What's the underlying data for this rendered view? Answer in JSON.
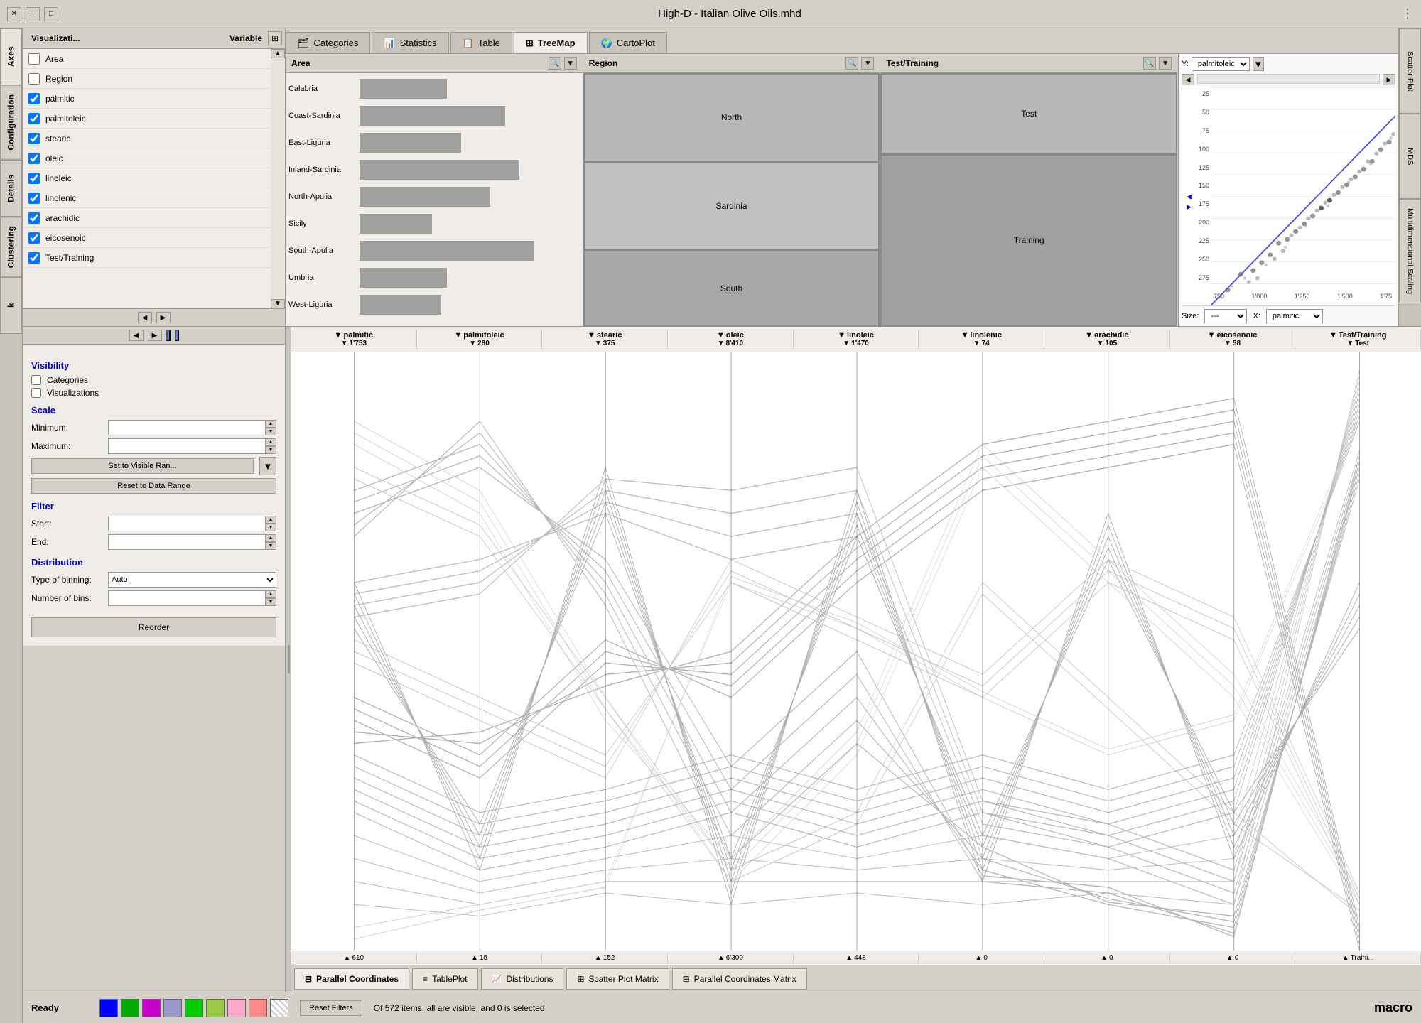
{
  "titlebar": {
    "title": "High-D - Italian Olive Oils.mhd",
    "close_btn": "✕",
    "min_btn": "−",
    "max_btn": "□"
  },
  "left_sidebar": {
    "tabs": [
      "Axes",
      "Configuration",
      "Details",
      "Clustering",
      "k"
    ]
  },
  "variable_panel": {
    "col1_label": "Visualizati...",
    "col2_label": "Variable",
    "variables": [
      {
        "name": "Area",
        "checked": false
      },
      {
        "name": "Region",
        "checked": false
      },
      {
        "name": "palmitic",
        "checked": true
      },
      {
        "name": "palmitoleic",
        "checked": true
      },
      {
        "name": "stearic",
        "checked": true
      },
      {
        "name": "oleic",
        "checked": true
      },
      {
        "name": "linoleic",
        "checked": true
      },
      {
        "name": "linolenic",
        "checked": true
      },
      {
        "name": "arachidic",
        "checked": true
      },
      {
        "name": "eicosenoic",
        "checked": true
      },
      {
        "name": "Test/Training",
        "checked": true
      }
    ]
  },
  "viz_tabs": {
    "tabs": [
      "Categories",
      "Statistics",
      "Table",
      "TreeMap",
      "CartoPlot"
    ],
    "active": "TreeMap"
  },
  "categories": {
    "area": {
      "label": "Area",
      "items": [
        {
          "name": "Calabria",
          "width": 0.3
        },
        {
          "name": "Coast-Sardinia",
          "width": 0.5
        },
        {
          "name": "East-Liguria",
          "width": 0.35
        },
        {
          "name": "Inland-Sardinia",
          "width": 0.55
        },
        {
          "name": "North-Apulia",
          "width": 0.45
        },
        {
          "name": "Sicily",
          "width": 0.25
        },
        {
          "name": "South-Apulia",
          "width": 0.6
        },
        {
          "name": "Umbria",
          "width": 0.3
        },
        {
          "name": "West-Liguria",
          "width": 0.28
        }
      ]
    },
    "region": {
      "label": "Region",
      "items": [
        {
          "name": "North",
          "width": 0.45
        },
        {
          "name": "Sardinia",
          "width": 0.55
        },
        {
          "name": "South",
          "width": 0.5
        }
      ]
    },
    "test_training": {
      "label": "Test/Training",
      "items": [
        {
          "name": "Test",
          "width": 0.35
        },
        {
          "name": "Training",
          "width": 0.65
        }
      ]
    }
  },
  "scatter": {
    "y_label": "Y:",
    "y_value": "palmitoleic",
    "size_label": "Size:",
    "size_value": "---",
    "x_label": "X:",
    "x_value": "palmitic",
    "y_axis_values": [
      "275",
      "250",
      "225",
      "200",
      "175",
      "150",
      "125",
      "100",
      "75",
      "50",
      "25"
    ],
    "x_axis_values": [
      "750",
      "1'000",
      "1'250",
      "1'500",
      "1'75"
    ]
  },
  "config": {
    "visibility_title": "Visibility",
    "categories_label": "Categories",
    "visualizations_label": "Visualizations",
    "scale_title": "Scale",
    "minimum_label": "Minimum:",
    "maximum_label": "Maximum:",
    "set_visible_btn": "Set to Visible Ran...",
    "reset_data_btn": "Reset to Data Range",
    "filter_title": "Filter",
    "start_label": "Start:",
    "end_label": "End:",
    "distribution_title": "Distribution",
    "binning_label": "Type of binning:",
    "binning_value": "Auto",
    "numbins_label": "Number of bins:",
    "reorder_btn": "Reorder"
  },
  "parallel": {
    "axes": [
      {
        "name": "palmitic",
        "max": "1'753",
        "min": "610"
      },
      {
        "name": "palmitoleic",
        "max": "280",
        "min": "15"
      },
      {
        "name": "stearic",
        "max": "375",
        "min": "152"
      },
      {
        "name": "oleic",
        "max": "8'410",
        "min": "6'300"
      },
      {
        "name": "linoleic",
        "max": "1'470",
        "min": "448"
      },
      {
        "name": "linolenic",
        "max": "74",
        "min": "0"
      },
      {
        "name": "arachidic",
        "max": "105",
        "min": "0"
      },
      {
        "name": "eicosenoic",
        "max": "58",
        "min": "0"
      },
      {
        "name": "Test/Training",
        "max": "Test",
        "min": "Traini..."
      }
    ]
  },
  "bottom_tabs": {
    "tabs": [
      "Parallel Coordinates",
      "TablePlot",
      "Distributions",
      "Scatter Plot Matrix",
      "Parallel Coordinates Matrix"
    ],
    "active": "Parallel Coordinates"
  },
  "statusbar": {
    "ready": "Ready",
    "colors": [
      "#0000ff",
      "#00aa00",
      "#cc00cc",
      "#9999cc",
      "#00cc00",
      "#99cc44",
      "#ffaacc",
      "#ff8888",
      "pattern"
    ],
    "message": "Of 572 items, all are visible, and 0 is selected",
    "reset_filters": "Reset Filters",
    "macro": "macro"
  },
  "right_sidebar": {
    "tabs": [
      "Scatter Plot",
      "MDS",
      "Multidimensional Scaling"
    ]
  },
  "training_label": "Training"
}
